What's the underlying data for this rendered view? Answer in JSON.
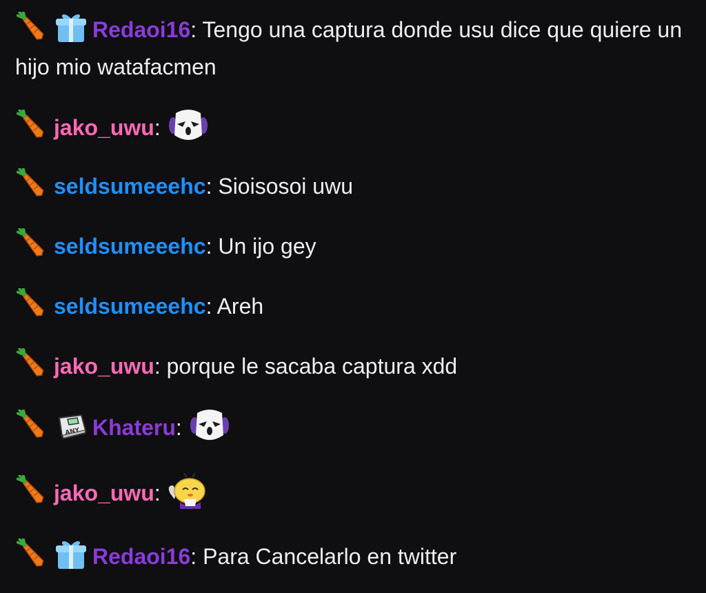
{
  "colors": {
    "background": "#0f0e11",
    "text": "#efeff1",
    "Redaoi16": "#8a3bd9",
    "jako_uwu": "#ff69b4",
    "seldsumeeehc": "#1e90ff",
    "Khateru": "#8a3bd9"
  },
  "messages": [
    {
      "badges": [
        "carrot-badge",
        "gift-badge"
      ],
      "user": "Redaoi16",
      "text": "Tengo una captura donde usu dice que quiere un hijo mio watafacmen"
    },
    {
      "badges": [
        "carrot-badge"
      ],
      "user": "jako_uwu",
      "text": "",
      "emote": "ghost-emote"
    },
    {
      "badges": [
        "carrot-badge"
      ],
      "user": "seldsumeeehc",
      "text": "Sioisosoi uwu"
    },
    {
      "badges": [
        "carrot-badge"
      ],
      "user": "seldsumeeehc",
      "text": "Un ijo gey"
    },
    {
      "badges": [
        "carrot-badge"
      ],
      "user": "seldsumeeehc",
      "text": "Areh"
    },
    {
      "badges": [
        "carrot-badge"
      ],
      "user": "jako_uwu",
      "text": "porque le sacaba captura xdd"
    },
    {
      "badges": [
        "carrot-badge",
        "any-key-badge"
      ],
      "user": "Khateru",
      "text": "",
      "emote": "ghost-emote"
    },
    {
      "badges": [
        "carrot-badge"
      ],
      "user": "jako_uwu",
      "text": "",
      "emote": "bee-emote"
    },
    {
      "badges": [
        "carrot-badge",
        "gift-badge"
      ],
      "user": "Redaoi16",
      "text": "Para Cancelarlo en twitter"
    }
  ],
  "badge_text": {
    "any_key": "ANY"
  }
}
